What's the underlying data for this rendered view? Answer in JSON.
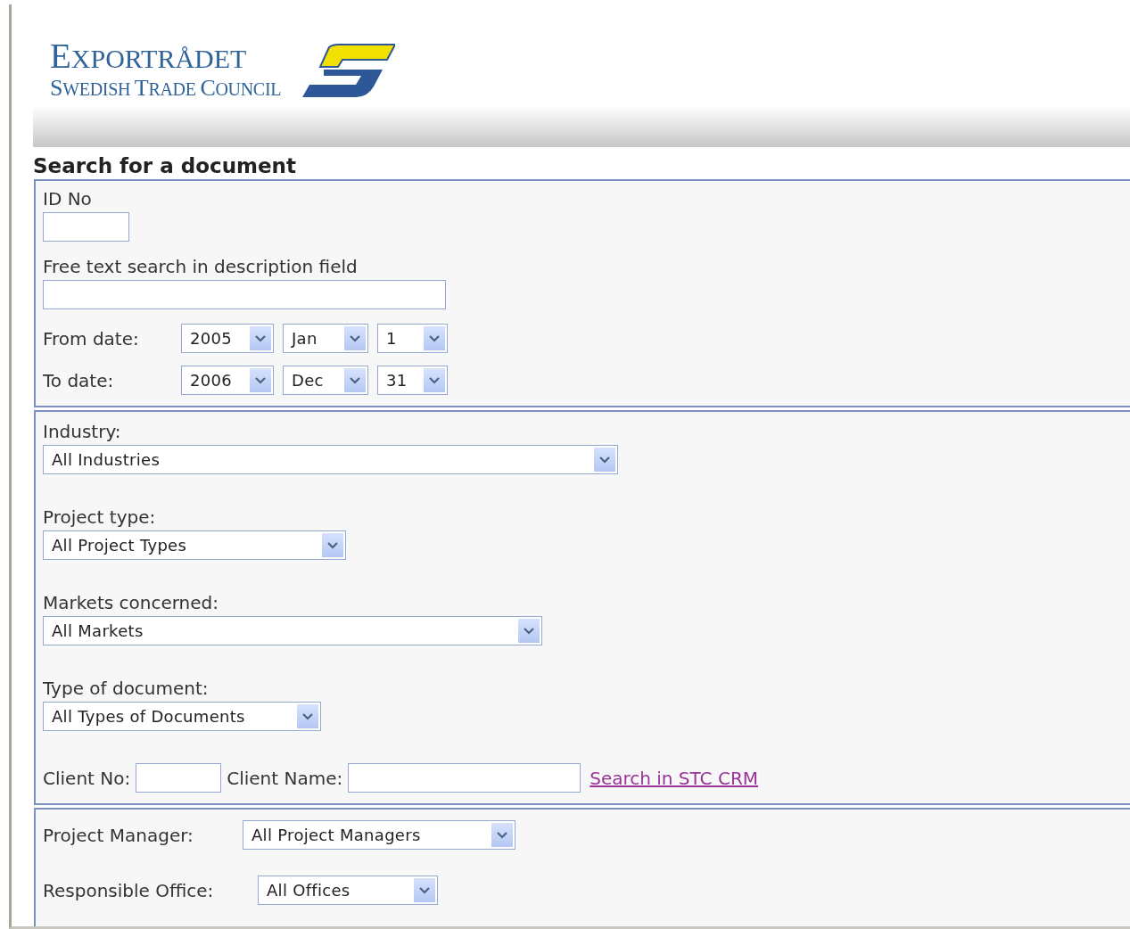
{
  "logo": {
    "name": "EXPORTRÅDET",
    "subtitle": "SWEDISH TRADE COUNCIL"
  },
  "title": "Search for a document",
  "sections": [
    {
      "items": [
        {
          "kind": "text",
          "label": "ID No"
        },
        {
          "kind": "text",
          "label": "Free text search in description field"
        },
        {
          "kind": "date",
          "label": "From date:",
          "selects": [
            "2005",
            "Jan",
            "1"
          ]
        },
        {
          "kind": "date",
          "label": "To date:",
          "selects": [
            "2006",
            "Dec",
            "31"
          ]
        }
      ]
    },
    {
      "items": [
        {
          "kind": "select",
          "label": "Industry:",
          "value": "All Industries"
        },
        {
          "kind": "select",
          "label": "Project type:",
          "value": "All Project Types"
        },
        {
          "kind": "select",
          "label": "Markets concerned:",
          "value": "All Markets"
        },
        {
          "kind": "select",
          "label": "Type of document:",
          "value": "All Types of Documents"
        },
        {
          "kind": "client",
          "fields": [
            {
              "label": "Client No:"
            },
            {
              "label": "Client Name:"
            }
          ],
          "link": "Search in STC CRM"
        }
      ]
    },
    {
      "items": [
        {
          "kind": "inline_select",
          "label": "Project Manager:",
          "value": "All Project Managers"
        },
        {
          "kind": "inline_select",
          "label": "Responsible Office:",
          "value": "All Offices"
        }
      ]
    }
  ]
}
